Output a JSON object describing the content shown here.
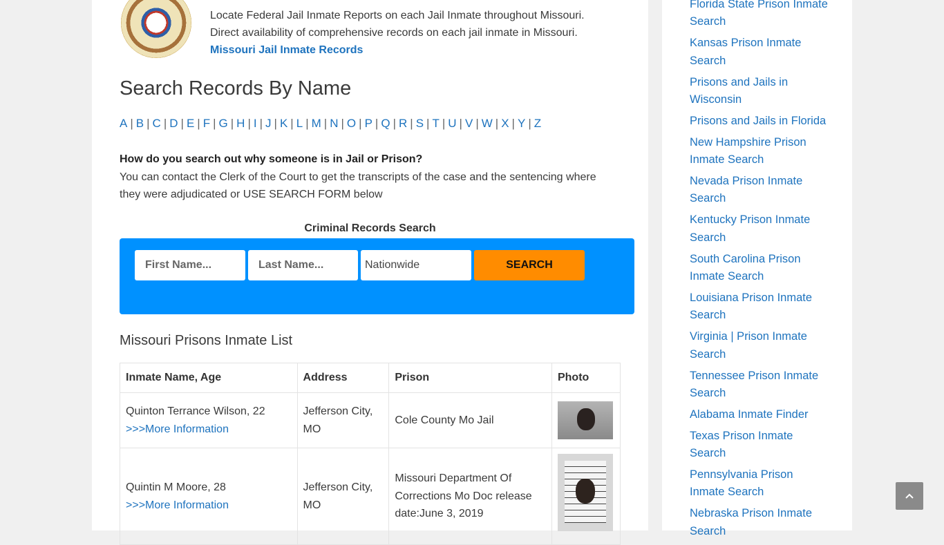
{
  "intro": {
    "line1": "Locate Federal Jail Inmate Reports on each Jail Inmate throughout Missouri.",
    "line2": "Direct availability of comprehensive records on each jail inmate in Missouri.",
    "link": "Missouri Jail Inmate Records",
    "seal_icon": "missouri-state-seal"
  },
  "search_title": "Search Records By Name",
  "alphabet": [
    "A",
    "B",
    "C",
    "D",
    "E",
    "F",
    "G",
    "H",
    "I",
    "J",
    "K",
    "L",
    "M",
    "N",
    "O",
    "P",
    "Q",
    "R",
    "S",
    "T",
    "U",
    "V",
    "W",
    "X",
    "Y",
    "Z"
  ],
  "faq": {
    "question": "How do you search out why someone is in Jail or Prison?",
    "answer": "You can contact the Clerk of the Court to get the transcripts of the case and the sentencing where they were adjudicated or USE SEARCH FORM below"
  },
  "search_form": {
    "title": "Criminal Records Search",
    "first_name_placeholder": "First Name...",
    "last_name_placeholder": "Last Name...",
    "location_value": "Nationwide",
    "button": "SEARCH",
    "colors": {
      "box": "#0091ff",
      "button": "#ff8c00"
    }
  },
  "inmate_list": {
    "title": "Missouri Prisons Inmate List",
    "headers": [
      "Inmate Name, Age",
      "Address",
      "Prison",
      "Photo"
    ],
    "rows": [
      {
        "name": "Quinton Terrance Wilson, 22",
        "link": ">>>More Information",
        "address": "Jefferson City, MO",
        "prison": "Cole County Mo Jail",
        "photo": "mugshot"
      },
      {
        "name": "Quintin M Moore, 28",
        "link": ">>>More Information",
        "address": "Jefferson City, MO",
        "prison": "Missouri Department Of Corrections Mo Doc release date:June 3, 2019",
        "photo": "mugshot"
      }
    ]
  },
  "sidebar": {
    "links": [
      "Florida State Prison Inmate Search",
      "Kansas Prison Inmate Search",
      "Prisons and Jails in Wisconsin",
      "Prisons and Jails in Florida",
      "New Hampshire Prison Inmate Search",
      "Nevada Prison Inmate Search",
      "Kentucky Prison Inmate Search",
      "South Carolina Prison Inmate Search",
      "Louisiana Prison Inmate Search",
      "Virginia | Prison Inmate Search",
      "Tennessee Prison Inmate Search",
      "Alabama Inmate Finder",
      "Texas Prison Inmate Search",
      "Pennsylvania Prison Inmate Search",
      "Nebraska Prison Inmate Search"
    ]
  },
  "back_to_top": {
    "icon": "chevron-up-icon",
    "glyph": "⌃"
  }
}
